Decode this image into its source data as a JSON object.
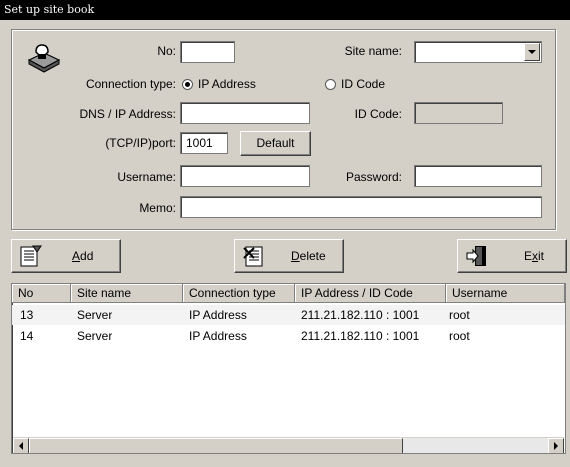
{
  "window": {
    "title": "Set up site book"
  },
  "form": {
    "no_label": "No:",
    "no_value": "",
    "site_name_label": "Site name:",
    "site_name_value": "",
    "connection_type_label": "Connection type:",
    "radio_ip": "IP Address",
    "radio_id": "ID Code",
    "connection_selected": "IP Address",
    "dns_label": "DNS / IP Address:",
    "dns_value": "",
    "id_code_label": "ID Code:",
    "id_code_value": "",
    "port_label": "(TCP/IP)port:",
    "port_value": "1001",
    "default_button": "Default",
    "username_label": "Username:",
    "username_value": "",
    "password_label": "Password:",
    "password_value": "",
    "memo_label": "Memo:",
    "memo_value": ""
  },
  "toolbar": {
    "add": {
      "label": "Add",
      "mnemonic": "A"
    },
    "delete": {
      "label": "Delete",
      "mnemonic": "D"
    },
    "exit": {
      "label": "Exit",
      "mnemonic": "x"
    }
  },
  "table": {
    "columns": [
      "No",
      "Site name",
      "Connection type",
      "IP Address / ID Code",
      "Username"
    ],
    "rows": [
      [
        "13",
        "Server",
        "IP Address",
        "211.21.182.110 : 1001",
        "root"
      ],
      [
        "14",
        "Server",
        "IP Address",
        "211.21.182.110 : 1001",
        "root"
      ]
    ]
  },
  "icons": {
    "header": "phone-book-icon",
    "add": "add-record-icon",
    "delete": "delete-record-icon",
    "exit": "exit-door-icon"
  }
}
